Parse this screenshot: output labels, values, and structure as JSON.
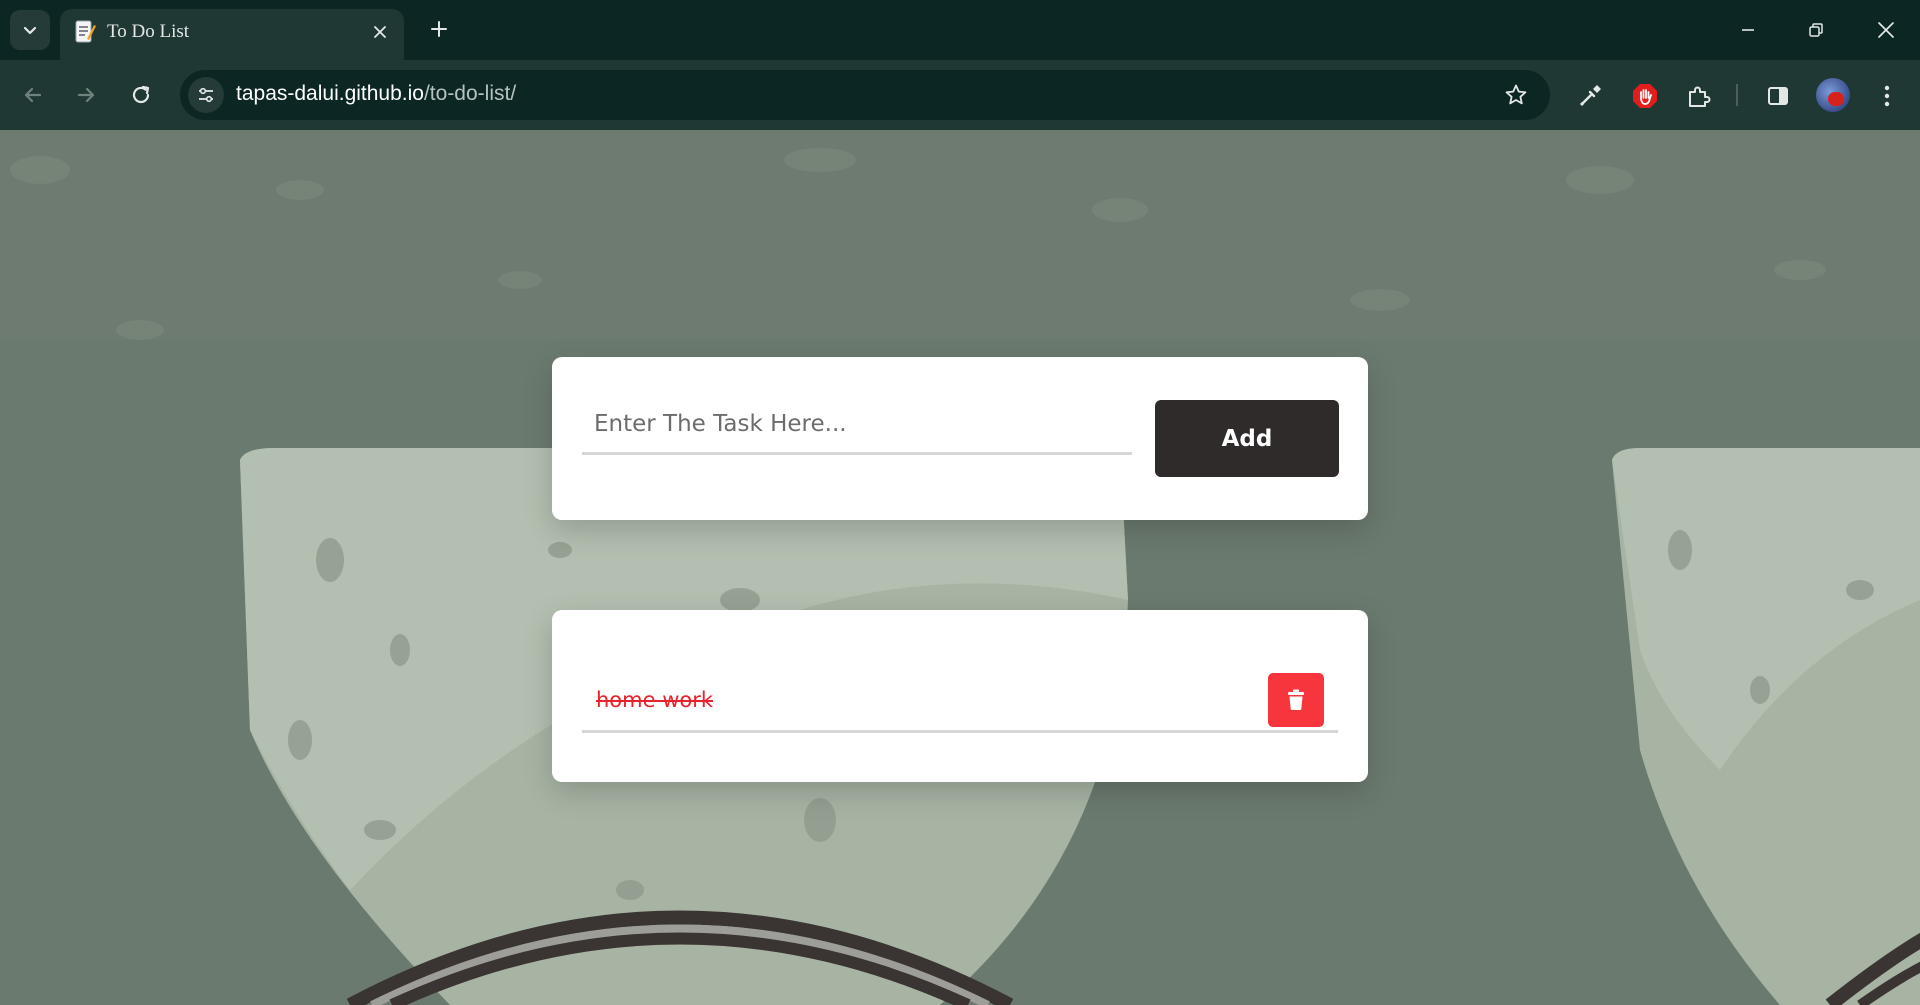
{
  "browser": {
    "tab_title": "To Do List",
    "url_host": "tapas-dalui.github.io",
    "url_path": "/to-do-list/",
    "accent_color": "#0b2623",
    "icons": [
      "tab-search-icon",
      "document-favicon-icon",
      "close-icon",
      "plus-icon",
      "minimize-icon",
      "restore-icon",
      "window-close-icon",
      "back-arrow-icon",
      "forward-arrow-icon",
      "reload-icon",
      "site-info-icon",
      "star-icon",
      "eyedropper-icon",
      "adblock-hand-icon",
      "puzzle-extension-icon",
      "side-panel-icon",
      "more-vert-icon"
    ]
  },
  "todo": {
    "input_placeholder": "Enter The Task Here...",
    "add_label": "Add",
    "tasks": [
      {
        "text": "home work",
        "completed": true
      }
    ],
    "colors": {
      "button_dark": "#2f2b2b",
      "delete_red": "#f6353d",
      "completed_text": "#e8232e"
    }
  }
}
